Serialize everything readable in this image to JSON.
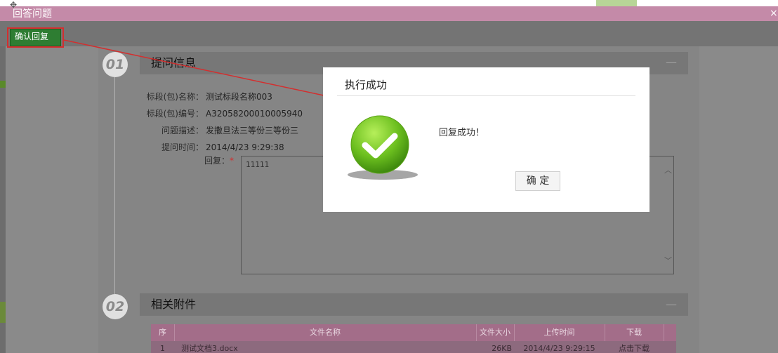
{
  "window": {
    "title": "回答问题",
    "move_icon": "move-icon",
    "close_icon": "close-icon"
  },
  "toolbar": {
    "confirm_reply_label": "确认回复"
  },
  "section1": {
    "number": "01",
    "title": "提问信息",
    "collapse": "—",
    "fields": [
      {
        "label": "标段(包)名称：",
        "value": "测试标段名称003"
      },
      {
        "label": "标段(包)编号：",
        "value": "A32058200010005940"
      },
      {
        "label": "问题描述：",
        "value": "发撒旦法三等份三等份三"
      },
      {
        "label": "提问时间：",
        "value": "2014/4/23 9:29:38"
      }
    ],
    "reply_label": "回复：",
    "reply_required": "*",
    "reply_value": "11111"
  },
  "section2": {
    "number": "02",
    "title": "相关附件",
    "collapse": "—",
    "columns": [
      "序",
      "文件名称",
      "文件大小",
      "上传时间",
      "下载"
    ],
    "rows": [
      {
        "index": "1",
        "name": "测试文档3.docx",
        "size": "26KB",
        "time": "2014/4/23 9:29:15",
        "download": "点击下载"
      }
    ]
  },
  "modal": {
    "title": "执行成功",
    "message": "回复成功！",
    "ok_label": "确 定",
    "icon": "success-check-icon"
  },
  "colors": {
    "titlebar": "#c48aa8",
    "confirm_button": "#2e7d32",
    "success_green": "#6cbf1f",
    "annotation_red": "#d32f2f"
  }
}
